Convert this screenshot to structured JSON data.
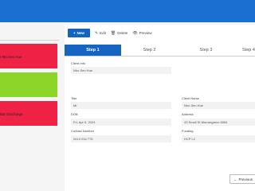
{
  "sidebar": {
    "cards": [
      {
        "text": "t Ma Sen Hue",
        "color": "#ef2245"
      },
      {
        "text": "",
        "color": "#8bd628"
      },
      {
        "text": "Bar Discharge",
        "color": "#ef2245"
      }
    ]
  },
  "toolbar": {
    "new_label": "New",
    "edit_label": "Edit",
    "delete_label": "Delete",
    "preview_label": "Preview"
  },
  "steps": [
    "Step 1",
    "Step 2",
    "Step 3",
    "Step 4"
  ],
  "form": {
    "client_info": {
      "label": "Client Info",
      "value": "Nho Sen Hue"
    },
    "title": {
      "label": "Title",
      "value": "Mr"
    },
    "client_name": {
      "label": "Client Name",
      "value": "Nho Sen Hue"
    },
    "dob": {
      "label": "DOB",
      "value": "Fri, Apr 5, 2024"
    },
    "address": {
      "label": "Address",
      "value": "43 Small St Murrangaroo 6064"
    },
    "contact_number": {
      "label": "Contact Number",
      "value": "0419 034 776"
    },
    "funding": {
      "label": "Funding",
      "value": "HCP L2"
    }
  },
  "footer": {
    "previous_label": "Previous"
  },
  "colors": {
    "accent": "#1565c0",
    "topbar": "#1a6fd1",
    "alert": "#ef2245",
    "success": "#8bd628"
  }
}
